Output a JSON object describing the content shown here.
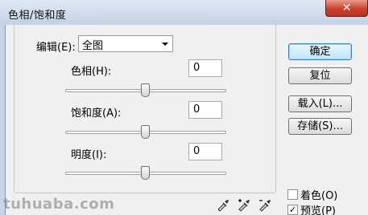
{
  "window": {
    "title": "色相/饱和度",
    "close_glyph": "✕"
  },
  "edit": {
    "label": "编辑(E):",
    "selected": "全图"
  },
  "controls": [
    {
      "label": "色相(H):",
      "value": "0",
      "slider_fraction": 0.5
    },
    {
      "label": "饱和度(A):",
      "value": "0",
      "slider_fraction": 0.5
    },
    {
      "label": "明度(I):",
      "value": "0",
      "slider_fraction": 0.5
    }
  ],
  "buttons": {
    "ok": "确定",
    "reset": "复位",
    "load": "载入(L)...",
    "save": "存储(S)..."
  },
  "options": {
    "colorize_label": "着色(O)",
    "colorize_checked": false,
    "preview_label": "预览(P)",
    "preview_checked": true
  },
  "tools": [
    "eyedropper-icon",
    "eyedropper-plus-icon",
    "eyedropper-minus-icon"
  ],
  "watermark": "tuhuaba.com"
}
